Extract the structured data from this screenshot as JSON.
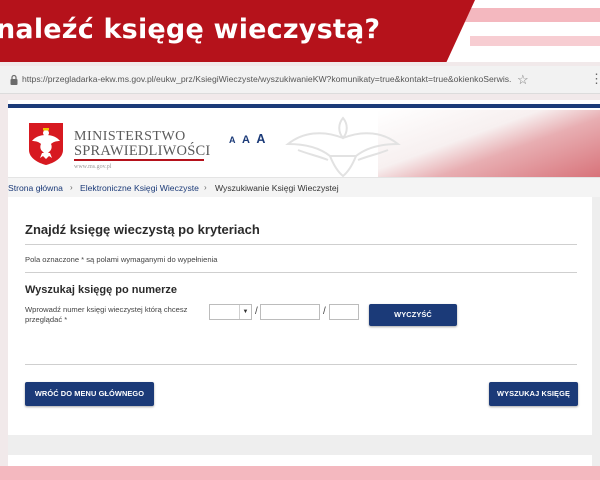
{
  "banner": {
    "title": "naleźć księgę wieczystą?",
    "accent_color": "#b5121b"
  },
  "browser": {
    "url": "https://przegladarka-ekw.ms.gov.pl/eukw_prz/KsiegiWieczyste/wyszukiwanieKW?komunikaty=true&kontakt=true&okienkoSerwis...",
    "lock_icon": "lock-icon",
    "star_icon": "star-icon",
    "menu_icon": "menu-dots-icon"
  },
  "header": {
    "ministry_line1": "MINISTERSTWO",
    "ministry_line2": "SPRAWIEDLIWOŚCI",
    "ministry_url": "www.ms.gov.pl",
    "font_size_small": "A",
    "font_size_medium": "A",
    "font_size_large": "A",
    "brand_color": "#1b3a78"
  },
  "breadcrumb": {
    "home": "Strona główna",
    "section": "Elektroniczne Księgi Wieczyste",
    "current": "Wyszukiwanie Księgi Wieczystej",
    "separator": "›"
  },
  "form": {
    "title": "Znajdź księgę wieczystą po kryteriach",
    "required_note": "Pola oznaczone * są polami wymaganymi do wypełnienia",
    "section_title": "Wyszukaj księgę po numerze",
    "number_label": "Wprowadź numer księgi wieczystej którą chcesz przeglądać *",
    "court_code_value": "",
    "number_value": "",
    "check_digit_value": "",
    "slash": "/",
    "clear_button": "WYCZYŚĆ"
  },
  "actions": {
    "back_button": "WRÓĆ DO MENU GŁÓWNEGO",
    "search_button": "WYSZUKAJ KSIĘGĘ"
  }
}
